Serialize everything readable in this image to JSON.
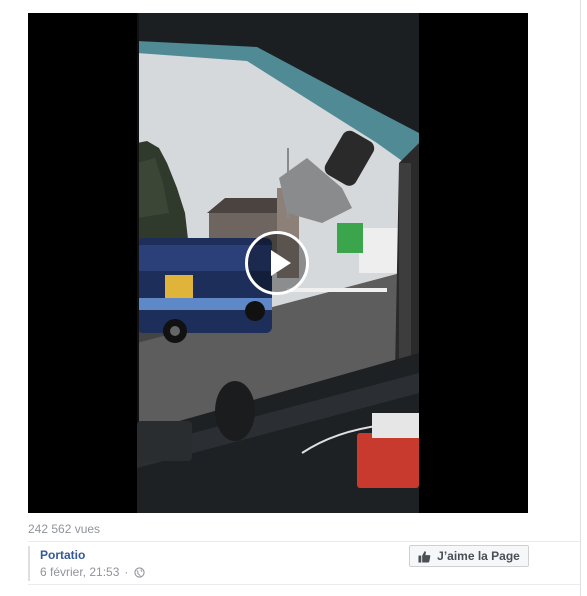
{
  "video": {
    "views_text": "242 562 vues",
    "player_icon": "play-icon",
    "scene": {
      "sky_color": "#d8dcde",
      "road_color": "#5b5b5b",
      "bus_color": "#1e2e5a",
      "bus_accent": "#e0b43a",
      "green_sign_color": "#3aa54a",
      "dash_color": "#1a1c1e"
    }
  },
  "post": {
    "page_name": "Portatio",
    "date": "6 février, 21:53",
    "separator": "·",
    "privacy_icon": "globe-icon"
  },
  "actions": {
    "like_page_label": "J’aime la Page",
    "like_icon": "thumbs-up-icon"
  }
}
